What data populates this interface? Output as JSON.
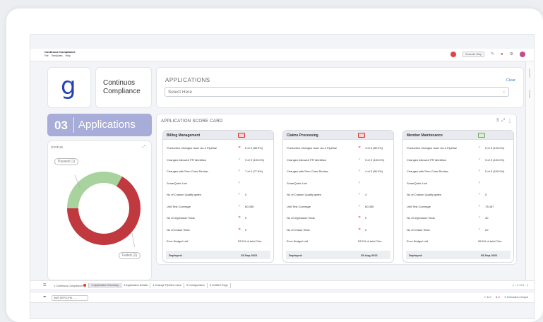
{
  "app": {
    "title": "Continuos Compliance",
    "menu": [
      "File",
      "Templates",
      "Help"
    ]
  },
  "topbar": {
    "execute_only": "Execute Only"
  },
  "side_labels": [
    "HISTORY",
    "FILTERS"
  ],
  "brand": {
    "letter": "g",
    "name": "Continuos Compliance"
  },
  "applications": {
    "label": "APPLICATIONS",
    "clear": "Clear",
    "placeholder": "Select Here"
  },
  "count": {
    "number": "03",
    "label": "Applications"
  },
  "status": {
    "title": "STATUS",
    "passed": "Passed (1)",
    "failed": "Failed (2)",
    "passed_count": 1,
    "failed_count": 2
  },
  "score_card": {
    "title": "APPLICATION SCORE CARD",
    "count": "3",
    "apps": [
      {
        "name": "Billing Management",
        "status": "failed",
        "metrics": [
          {
            "label": "Production Changes done via a Pipeline",
            "mark": "cross",
            "value": "8 of 9 (88.9%)"
          },
          {
            "label": "Changes followed PR Workflow",
            "mark": "check",
            "value": "9 of 9 (100.0%)"
          },
          {
            "label": "Changes with Peer Code Review",
            "mark": "check",
            "value": "7 of 9 (77.8%)"
          },
          {
            "label": "SonarQube Link",
            "mark": "check",
            "value": ""
          },
          {
            "label": "No of Custom Quality gates",
            "mark": "check",
            "value": "0"
          },
          {
            "label": "Unit Test Coverage",
            "mark": "check",
            "value": "60.085"
          },
          {
            "label": "No of regression Tests",
            "mark": "cross",
            "value": "0"
          },
          {
            "label": "No of Chaos Tests",
            "mark": "cross",
            "value": "0"
          },
          {
            "label": "Error Budget Left",
            "mark": "",
            "value": "53.2% of total 7drs"
          }
        ],
        "deployed_label": "Deployed:",
        "deployed": "15-Sep-2021"
      },
      {
        "name": "Claims Processing",
        "status": "failed",
        "metrics": [
          {
            "label": "Production Changes done via a Pipeline",
            "mark": "cross",
            "value": "4 of 5 (80.0%)"
          },
          {
            "label": "Changes followed PR Workflow",
            "mark": "check",
            "value": "5 of 5 (100.0%)"
          },
          {
            "label": "Changes with Peer Code Review",
            "mark": "check",
            "value": "4 of 5 (80.0%)"
          },
          {
            "label": "SonarQube Link",
            "mark": "check",
            "value": ""
          },
          {
            "label": "No of Custom Quality gates",
            "mark": "check",
            "value": "4"
          },
          {
            "label": "Unit Test Coverage",
            "mark": "check",
            "value": "60.085"
          },
          {
            "label": "No of regression Tests",
            "mark": "cross",
            "value": "0"
          },
          {
            "label": "No of Chaos Tests",
            "mark": "cross",
            "value": "0"
          },
          {
            "label": "Error Budget Left",
            "mark": "",
            "value": "53.2% of total 7drs"
          }
        ],
        "deployed_label": "Deployed:",
        "deployed": "25-Aug-2021"
      },
      {
        "name": "Member Maintenance",
        "status": "passed",
        "metrics": [
          {
            "label": "Production Changes done via a Pipeline",
            "mark": "check",
            "value": "5 of 5 (100.0%)"
          },
          {
            "label": "Changes followed PR Workflow",
            "mark": "check",
            "value": "5 of 5 (100.0%)"
          },
          {
            "label": "Changes with Peer Code Review",
            "mark": "check",
            "value": "5 of 5 (100.0%)"
          },
          {
            "label": "SonarQube Link",
            "mark": "check",
            "value": ""
          },
          {
            "label": "No of Custom Quality gates",
            "mark": "check",
            "value": "5"
          },
          {
            "label": "Unit Test Coverage",
            "mark": "check",
            "value": "73.067"
          },
          {
            "label": "No of regression Tests",
            "mark": "check",
            "value": "30"
          },
          {
            "label": "No of Chaos Tests",
            "mark": "check",
            "value": "20"
          },
          {
            "label": "Error Budget Left",
            "mark": "",
            "value": "95.6% of total 7drs"
          }
        ],
        "deployed_label": "Deployed:",
        "deployed": "05-Sep-2021"
      }
    ]
  },
  "tabs": [
    {
      "label": "1 Continuos Compliance",
      "active": false,
      "badge": true
    },
    {
      "label": "2 Application Summary",
      "active": true,
      "badge": false
    },
    {
      "label": "3 Application Details",
      "active": false,
      "badge": false
    },
    {
      "label": "4 Change Pipeline trace",
      "active": false,
      "badge": false
    },
    {
      "label": "5 Configuration",
      "active": false,
      "badge": false
    },
    {
      "label": "6 Untitled Page",
      "active": false,
      "badge": false
    }
  ],
  "pager": {
    "text": "2 of 6"
  },
  "bottom": {
    "env": "AWS DEPLOYM...",
    "ok_count": "117",
    "err_count": "0",
    "graph": "Execution Graph"
  },
  "colors": {
    "accent": "#a7acd8",
    "passed": "#a9d39e",
    "failed": "#c0393f",
    "brand": "#2541b2"
  }
}
